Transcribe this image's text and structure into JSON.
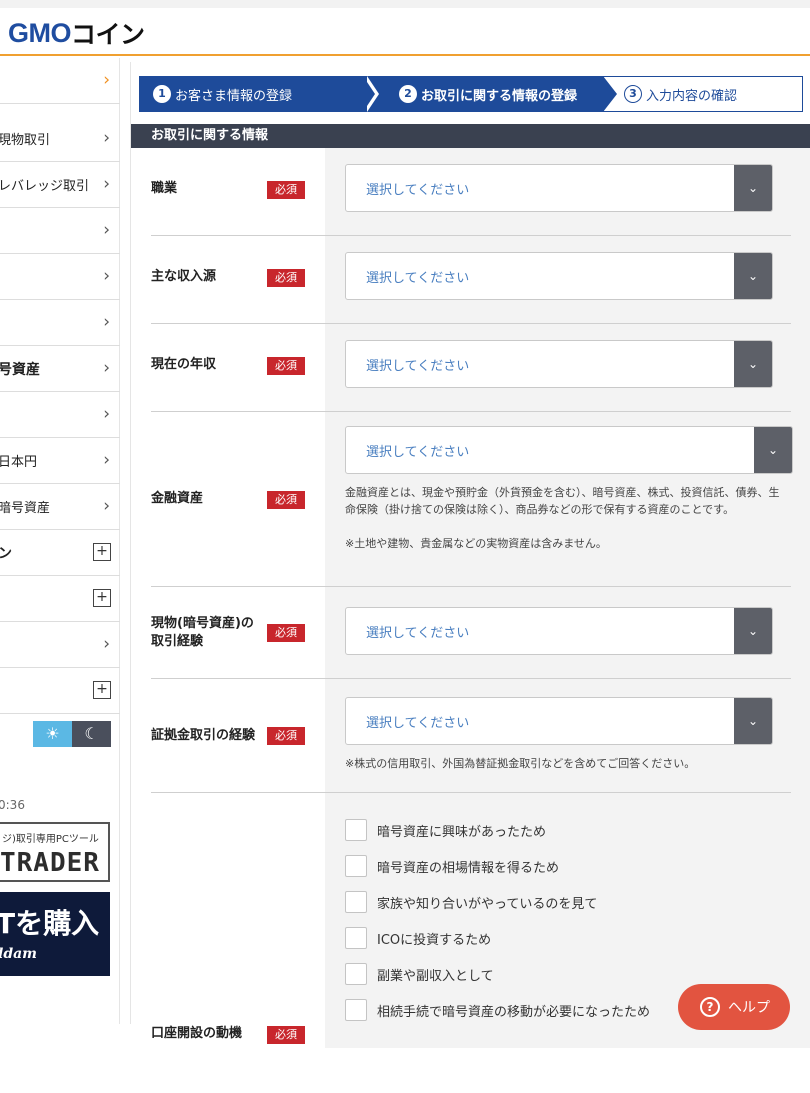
{
  "header": {
    "logo_text": "GMO",
    "logo_jp": "コイン"
  },
  "sidebar": {
    "items": [
      {
        "label": "",
        "icon": "chevron-right-icon"
      },
      {
        "label": "現物取引",
        "icon": "chevron-right-icon"
      },
      {
        "label": "レバレッジ取引",
        "icon": "chevron-right-icon"
      },
      {
        "label": "",
        "icon": "chevron-right-icon"
      },
      {
        "label": "",
        "icon": "chevron-right-icon"
      },
      {
        "label": "",
        "icon": "chevron-right-icon"
      },
      {
        "label": "号資産",
        "icon": "chevron-right-icon"
      },
      {
        "label": "",
        "icon": "chevron-right-icon"
      },
      {
        "label": "日本円",
        "icon": "chevron-right-icon"
      },
      {
        "label": "暗号資産",
        "icon": "chevron-right-icon"
      },
      {
        "label": "ン",
        "icon": "plus-icon"
      },
      {
        "label": "",
        "icon": "plus-icon"
      },
      {
        "label": "",
        "icon": "chevron-right-icon"
      },
      {
        "label": "",
        "icon": "plus-icon"
      }
    ],
    "time_text": "0:36",
    "banner1_small": "ジ)取引専用PCツール",
    "banner1_big": "TRADER",
    "banner2_big": "Tを購入",
    "banner2_sub": "ldam"
  },
  "stepper": {
    "step1": {
      "num": "1",
      "label": "お客さま情報の登録"
    },
    "step2": {
      "num": "2",
      "label": "お取引に関する情報の登録"
    },
    "step3": {
      "num": "3",
      "label": "入力内容の確認"
    }
  },
  "section_title": "お取引に関する情報",
  "required_label": "必須",
  "select_placeholder": "選択してください",
  "fields": {
    "occupation": "職業",
    "income_source": "主な収入源",
    "annual_income": "現在の年収",
    "financial_assets": "金融資産",
    "spot_experience_line1": "現物(暗号資産)の",
    "spot_experience_line2": "取引経験",
    "margin_experience": "証拠金取引の経験",
    "motive": "口座開設の動機"
  },
  "notes": {
    "financial_assets": "金融資産とは、現金や預貯金（外貨預金を含む）、暗号資産、株式、投資信託、債券、生命保険（掛け捨ての保険は除く）、商品券などの形で保有する資産のことです。",
    "financial_assets_2": "※土地や建物、貴金属などの実物資産は含みません。",
    "margin": "※株式の信用取引、外国為替証拠金取引などを含めてご回答ください。"
  },
  "motives": [
    "暗号資産に興味があったため",
    "暗号資産の相場情報を得るため",
    "家族や知り合いがやっているのを見て",
    "ICOに投資するため",
    "副業や副収入として",
    "相続手続で暗号資産の移動が必要になったため"
  ],
  "help_button": "ヘルプ",
  "colors": {
    "brand_blue": "#1e4b9a",
    "required_red": "#c8262c",
    "help_red": "#e25440",
    "accent_orange": "#f0a030"
  }
}
